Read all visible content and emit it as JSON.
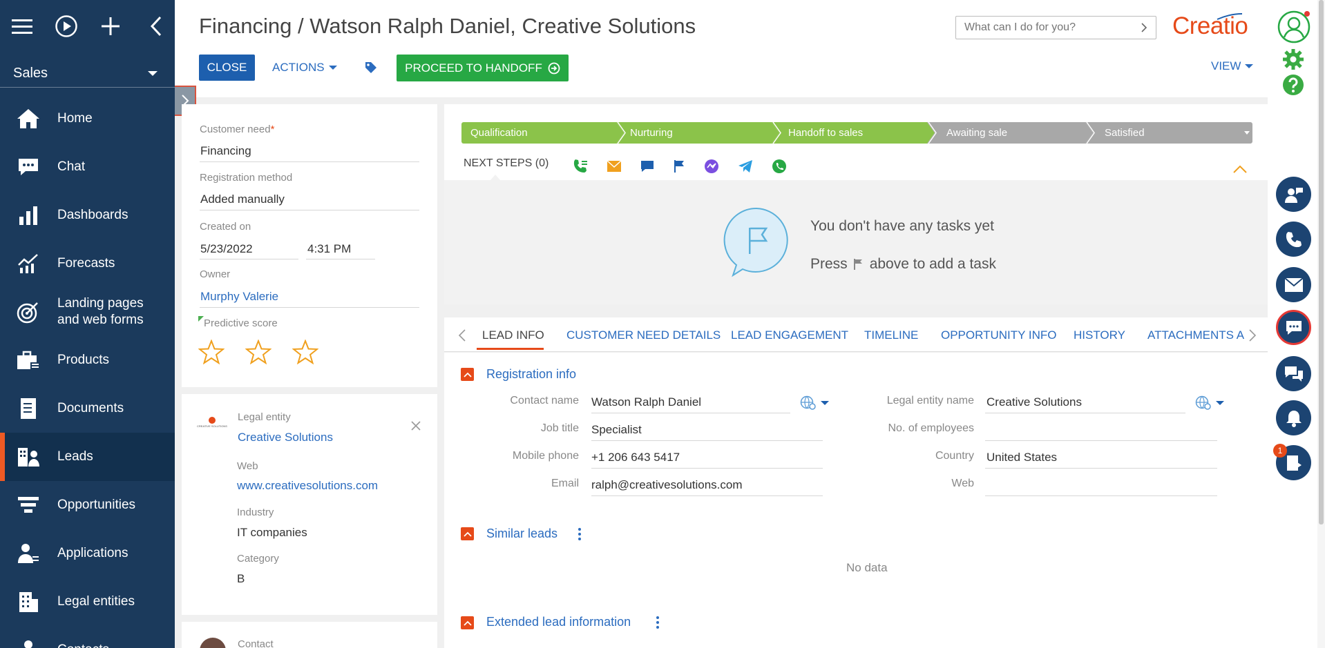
{
  "nav": {
    "workspace": "Sales",
    "items": [
      {
        "label": "Home",
        "icon": "home-icon"
      },
      {
        "label": "Chat",
        "icon": "chat-icon"
      },
      {
        "label": "Dashboards",
        "icon": "dashboards-icon"
      },
      {
        "label": "Forecasts",
        "icon": "forecasts-icon"
      },
      {
        "label": "Landing pages and web forms",
        "line1": "Landing pages",
        "line2": "and web forms",
        "icon": "target-icon"
      },
      {
        "label": "Products",
        "icon": "products-icon"
      },
      {
        "label": "Documents",
        "icon": "documents-icon"
      },
      {
        "label": "Leads",
        "icon": "leads-icon"
      },
      {
        "label": "Opportunities",
        "icon": "opportunities-icon"
      },
      {
        "label": "Applications",
        "icon": "applications-icon"
      },
      {
        "label": "Legal entities",
        "icon": "legal-entities-icon"
      },
      {
        "label": "Contacts",
        "icon": "contacts-icon"
      }
    ]
  },
  "header": {
    "title": "Financing / Watson Ralph Daniel, Creative Solutions",
    "close_label": "CLOSE",
    "actions_label": "ACTIONS",
    "proceed_label": "PROCEED TO HANDOFF",
    "view_label": "VIEW",
    "search_placeholder": "What can I do for you?",
    "logo": "Creatio"
  },
  "left_card": {
    "customer_need_label": "Customer need",
    "customer_need_required": "*",
    "customer_need_value": "Financing",
    "registration_method_label": "Registration method",
    "registration_method_value": "Added manually",
    "created_on_label": "Created on",
    "created_date": "5/23/2022",
    "created_time": "4:31 PM",
    "owner_label": "Owner",
    "owner_value": "Murphy Valerie",
    "predictive_score_label": "Predictive score",
    "score_stars": 0,
    "score_max": 3
  },
  "legal_card": {
    "logo_text": "CREATIVE SOLUTIONS",
    "legal_entity_label": "Legal entity",
    "legal_entity_value": "Creative Solutions",
    "web_label": "Web",
    "web_value": "www.creativesolutions.com",
    "industry_label": "Industry",
    "industry_value": "IT companies",
    "category_label": "Category",
    "category_value": "B"
  },
  "contact_card": {
    "contact_label": "Contact"
  },
  "stages": [
    {
      "label": "Qualification",
      "state": "done"
    },
    {
      "label": "Nurturing",
      "state": "done"
    },
    {
      "label": "Handoff to sales",
      "state": "current"
    },
    {
      "label": "Awaiting sale",
      "state": "todo"
    },
    {
      "label": "Satisfied",
      "state": "todo"
    }
  ],
  "next_steps": {
    "label": "NEXT STEPS (0)",
    "empty_title": "You don't have any tasks yet",
    "empty_hint_before": "Press",
    "empty_hint_after": "above to add a task"
  },
  "tabs": [
    "LEAD INFO",
    "CUSTOMER NEED DETAILS",
    "LEAD ENGAGEMENT",
    "TIMELINE",
    "OPPORTUNITY INFO",
    "HISTORY",
    "ATTACHMENTS AN"
  ],
  "registration": {
    "title": "Registration info",
    "contact_name_label": "Contact name",
    "contact_name_value": "Watson Ralph Daniel",
    "job_title_label": "Job title",
    "job_title_value": "Specialist",
    "mobile_label": "Mobile phone",
    "mobile_value": "+1 206 643 5417",
    "email_label": "Email",
    "email_value": "ralph@creativesolutions.com",
    "legal_entity_name_label": "Legal entity name",
    "legal_entity_name_value": "Creative Solutions",
    "employees_label": "No. of employees",
    "employees_value": "",
    "country_label": "Country",
    "country_value": "United States",
    "web_label": "Web",
    "web_value": ""
  },
  "similar_leads": {
    "title": "Similar leads",
    "empty": "No data"
  },
  "extended": {
    "title": "Extended lead information"
  },
  "notifications_badge": "1",
  "colors": {
    "nav_bg": "#1b3a5c",
    "accent": "#e64a19",
    "link": "#2b6cbf",
    "stage_done": "#8bc34a",
    "stage_todo": "#a8a8a8",
    "proceed": "#27a844",
    "close_btn": "#1d5fae"
  }
}
